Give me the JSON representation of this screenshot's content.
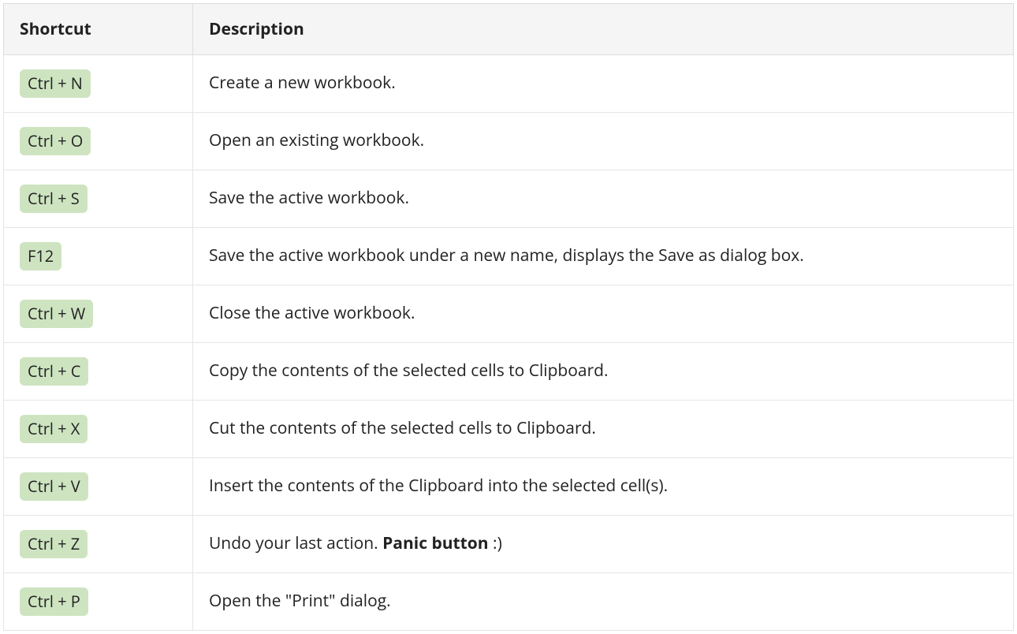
{
  "table": {
    "headers": {
      "shortcut": "Shortcut",
      "description": "Description"
    },
    "rows": [
      {
        "shortcut": "Ctrl + N",
        "desc_before": "Create a new workbook.",
        "desc_bold": "",
        "desc_after": ""
      },
      {
        "shortcut": "Ctrl + O",
        "desc_before": "Open an existing workbook.",
        "desc_bold": "",
        "desc_after": ""
      },
      {
        "shortcut": "Ctrl + S",
        "desc_before": "Save the active workbook.",
        "desc_bold": "",
        "desc_after": ""
      },
      {
        "shortcut": "F12",
        "desc_before": "Save the active workbook under a new name, displays the Save as dialog box.",
        "desc_bold": "",
        "desc_after": ""
      },
      {
        "shortcut": "Ctrl + W",
        "desc_before": "Close the active workbook.",
        "desc_bold": "",
        "desc_after": ""
      },
      {
        "shortcut": "Ctrl + C",
        "desc_before": "Copy the contents of the selected cells to Clipboard.",
        "desc_bold": "",
        "desc_after": ""
      },
      {
        "shortcut": "Ctrl + X",
        "desc_before": "Cut the contents of the selected cells to Clipboard.",
        "desc_bold": "",
        "desc_after": ""
      },
      {
        "shortcut": "Ctrl + V",
        "desc_before": "Insert the contents of the Clipboard into the selected cell(s).",
        "desc_bold": "",
        "desc_after": ""
      },
      {
        "shortcut": "Ctrl + Z",
        "desc_before": "Undo your last action. ",
        "desc_bold": "Panic button",
        "desc_after": " :)"
      },
      {
        "shortcut": "Ctrl + P",
        "desc_before": "Open the \"Print\" dialog.",
        "desc_bold": "",
        "desc_after": ""
      }
    ]
  }
}
